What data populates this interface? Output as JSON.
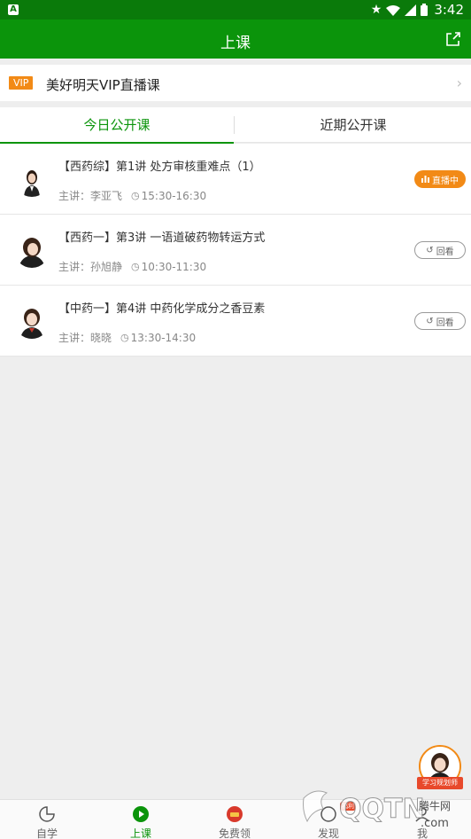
{
  "status": {
    "time": "3:42"
  },
  "appbar": {
    "title": "上课"
  },
  "vip": {
    "tag": "VIP",
    "text": "美好明天VIP直播课"
  },
  "tabs": [
    {
      "label": "今日公开课",
      "active": true
    },
    {
      "label": "近期公开课",
      "active": false
    }
  ],
  "courses": [
    {
      "title": "【西药综】第1讲 处方审核重难点（1）",
      "teacher": "主讲：李亚飞",
      "time": "15:30-16:30",
      "status": "直播中",
      "status_type": "live"
    },
    {
      "title": "【西药一】第3讲 一语道破药物转运方式",
      "teacher": "主讲：孙旭静",
      "time": "10:30-11:30",
      "status": "回看",
      "status_type": "replay"
    },
    {
      "title": "【中药一】第4讲 中药化学成分之香豆素",
      "teacher": "主讲：晓晓",
      "time": "13:30-14:30",
      "status": "回看",
      "status_type": "replay"
    }
  ],
  "float_promo": {
    "label": "学习规划师"
  },
  "bottom_nav": [
    {
      "label": "自学",
      "icon": "pacman-icon"
    },
    {
      "label": "上课",
      "icon": "play-circle-icon",
      "active": true
    },
    {
      "label": "免费领",
      "icon": "gift-icon"
    },
    {
      "label": "发现",
      "icon": "discover-icon",
      "badge": "福利"
    },
    {
      "label": "我",
      "icon": "user-icon"
    }
  ],
  "watermark": {
    "text": "QQTN",
    "cn": "腾牛网",
    "url": ".com"
  },
  "colors": {
    "primary": "#0b940b",
    "statusbar": "#0a7a0a",
    "accent": "#f28a16"
  }
}
